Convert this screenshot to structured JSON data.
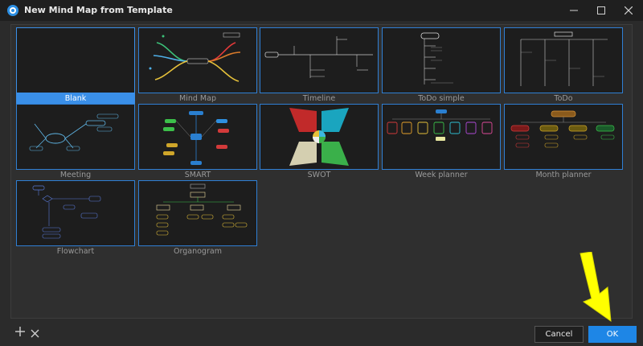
{
  "window": {
    "title": "New Mind Map from Template",
    "icon": "app-logo-icon",
    "controls": [
      "minimize-icon",
      "maximize-icon",
      "close-icon"
    ]
  },
  "templates": [
    {
      "label": "Blank",
      "selected": true
    },
    {
      "label": "Mind Map",
      "selected": false
    },
    {
      "label": "Timeline",
      "selected": false
    },
    {
      "label": "ToDo simple",
      "selected": false
    },
    {
      "label": "ToDo",
      "selected": false
    },
    {
      "label": "Meeting",
      "selected": false
    },
    {
      "label": "SMART",
      "selected": false
    },
    {
      "label": "SWOT",
      "selected": false
    },
    {
      "label": "Week planner",
      "selected": false
    },
    {
      "label": "Month planner",
      "selected": false
    },
    {
      "label": "Flowchart",
      "selected": false
    },
    {
      "label": "Organogram",
      "selected": false
    }
  ],
  "footer": {
    "add_icon": "plus-icon",
    "remove_icon": "x-icon",
    "cancel_label": "Cancel",
    "ok_label": "OK"
  },
  "colors": {
    "accent": "#1e86e6",
    "annotation_arrow": "#ffff00"
  }
}
